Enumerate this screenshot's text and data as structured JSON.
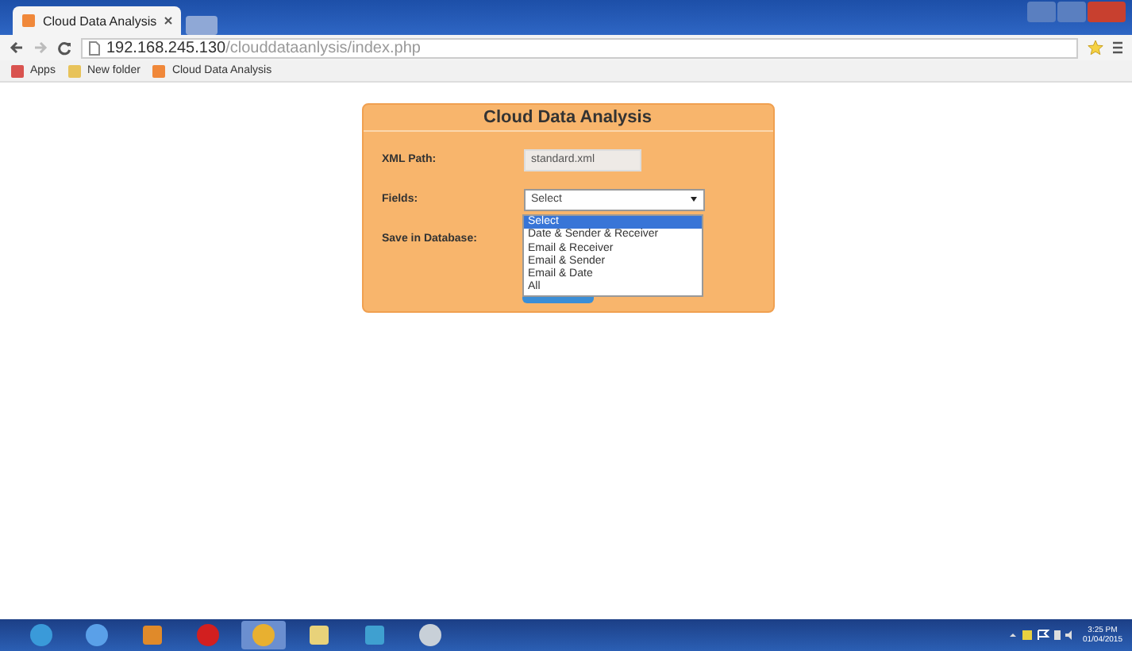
{
  "browser": {
    "tab_title": "Cloud Data Analysis",
    "address_host": "192.168.245.130",
    "address_path": "/clouddataanlysis/index.php",
    "bookmarks": [
      {
        "label": "Apps",
        "kind": "apps"
      },
      {
        "label": "New folder",
        "kind": "folder"
      },
      {
        "label": "Cloud Data Analysis",
        "kind": "page"
      }
    ]
  },
  "form": {
    "title": "Cloud Data Analysis",
    "xml_path_label": "XML Path:",
    "xml_path_value": "standard.xml",
    "fields_label": "Fields:",
    "fields_value": "Select",
    "save_label": "Save in Database:",
    "options": [
      {
        "label": "Select",
        "selected": true
      },
      {
        "label": "Date & Sender & Receiver",
        "selected": false
      },
      {
        "label": "Email & Receiver",
        "selected": false
      },
      {
        "label": "Email & Sender",
        "selected": false
      },
      {
        "label": "Email & Date",
        "selected": false
      },
      {
        "label": "All",
        "selected": false
      }
    ]
  },
  "taskbar": {
    "time": "3:25 PM",
    "date": "01/04/2015"
  }
}
